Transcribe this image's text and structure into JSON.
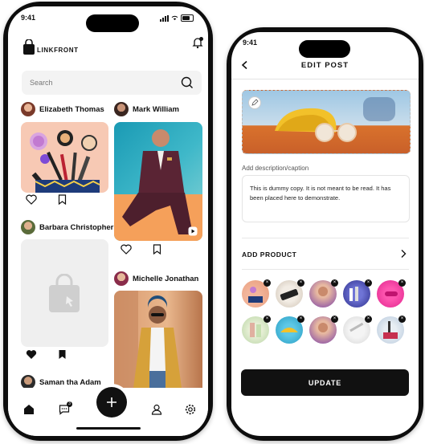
{
  "left_screen": {
    "status_time": "9:41",
    "brand": "LINKFRONT",
    "search_placeholder": "Search",
    "feed": [
      {
        "user": "Elizabeth Thomas"
      },
      {
        "user": "Mark William"
      },
      {
        "user": "Barbara Christopher"
      },
      {
        "user": "Michelle Jonathan"
      },
      {
        "user": "Saman tha Adam"
      }
    ],
    "chat_badge": "3",
    "tabs": [
      "home-icon",
      "chat-icon",
      "add-icon",
      "profile-icon",
      "settings-icon"
    ]
  },
  "right_screen": {
    "status_time": "9:41",
    "title": "EDIT POST",
    "caption_label": "Add description/caption",
    "caption_text": "This is dummy copy. It is not meant to be read. It has been placed here to demonstrate.",
    "add_product_label": "ADD PRODUCT",
    "update_label": "UPDATE"
  },
  "colors": {
    "accent": "#111111",
    "background": "#ffffff",
    "input": "#f3f3f3"
  }
}
